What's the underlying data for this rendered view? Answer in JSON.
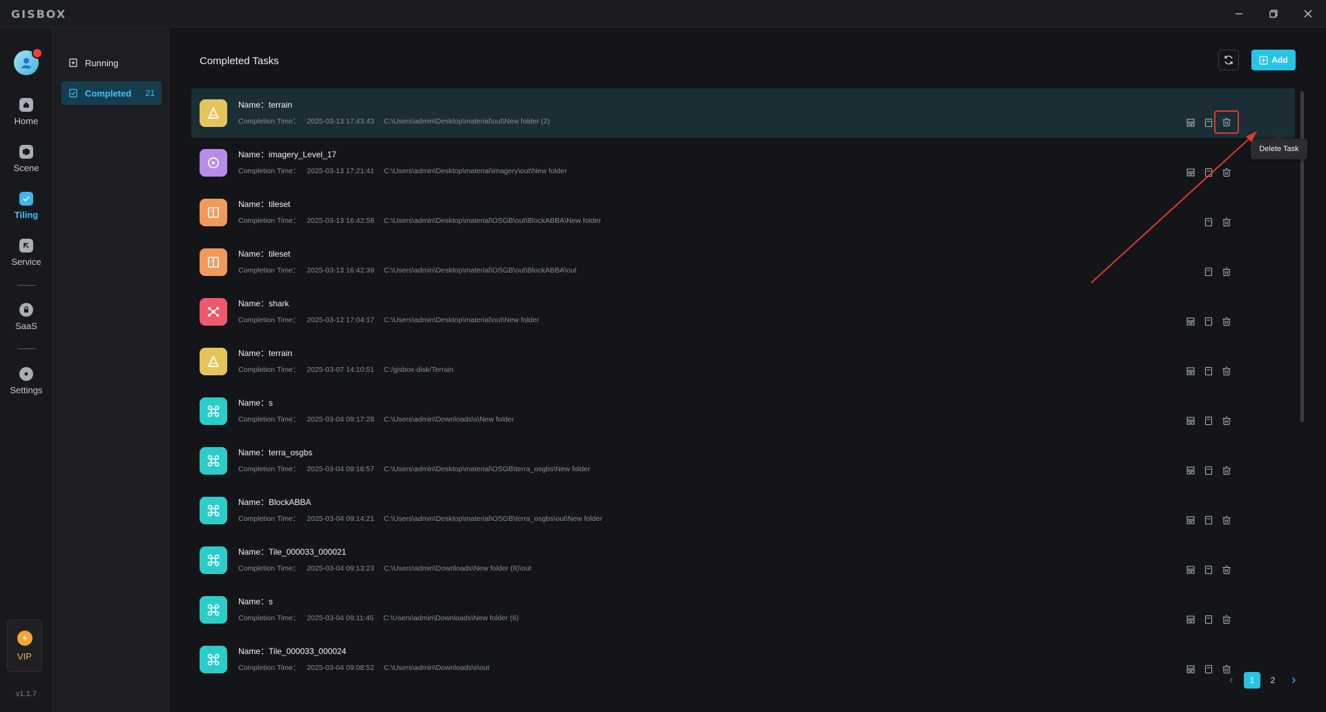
{
  "app": {
    "logo": "GISBOX",
    "version": "v1.1.7"
  },
  "nav": {
    "items": [
      {
        "label": "Home",
        "icon": "home-icon"
      },
      {
        "label": "Scene",
        "icon": "cube-icon"
      },
      {
        "label": "Tiling",
        "icon": "tiling-icon",
        "active": true
      },
      {
        "label": "Service",
        "icon": "service-icon"
      },
      {
        "label": "SaaS",
        "icon": "lock-icon"
      },
      {
        "label": "Settings",
        "icon": "gear-icon"
      }
    ],
    "vip_label": "VIP"
  },
  "sub": {
    "running_label": "Running",
    "completed_label": "Completed",
    "completed_count": "21"
  },
  "main": {
    "title": "Completed Tasks",
    "add_label": "Add",
    "tooltip": "Delete Task",
    "name_prefix": "Name：",
    "time_prefix": "Completion Time：",
    "accent": "#28c4e8",
    "tasks": [
      {
        "name": "terrain",
        "time": "2025-03-13 17:43:43",
        "path": "C:\\Users\\admin\\Desktop\\material\\out\\New folder (2)",
        "type": "terrain",
        "actions": 3
      },
      {
        "name": "imagery_Level_17",
        "time": "2025-03-13 17:21:41",
        "path": "C:\\Users\\admin\\Desktop\\material\\imagery\\out\\New folder",
        "type": "imagery",
        "actions": 3
      },
      {
        "name": "tileset",
        "time": "2025-03-13 16:42:58",
        "path": "C:\\Users\\admin\\Desktop\\material\\OSGB\\out\\BlockABBA\\New folder",
        "type": "tileset",
        "actions": 2
      },
      {
        "name": "tileset",
        "time": "2025-03-13 16:42:39",
        "path": "C:\\Users\\admin\\Desktop\\material\\OSGB\\out\\BlockABBA\\out",
        "type": "tileset",
        "actions": 2
      },
      {
        "name": "shark",
        "time": "2025-03-12 17:04:17",
        "path": "C:\\Users\\admin\\Desktop\\material\\out\\New folder",
        "type": "model",
        "actions": 3
      },
      {
        "name": "terrain",
        "time": "2025-03-07 14:10:51",
        "path": "C:/gisbox-disk/Terrain",
        "type": "terrain",
        "actions": 3
      },
      {
        "name": "s",
        "time": "2025-03-04 09:17:28",
        "path": "C:\\Users\\admin\\Downloads\\s\\New folder",
        "type": "osgb",
        "actions": 3
      },
      {
        "name": "terra_osgbs",
        "time": "2025-03-04 09:18:57",
        "path": "C:\\Users\\admin\\Desktop\\material\\OSGB\\terra_osgbs\\New folder",
        "type": "osgb",
        "actions": 3
      },
      {
        "name": "BlockABBA",
        "time": "2025-03-04 09:14:21",
        "path": "C:\\Users\\admin\\Desktop\\material\\OSGB\\terra_osgbs\\out\\New folder",
        "type": "osgb",
        "actions": 3
      },
      {
        "name": "Tile_000033_000021",
        "time": "2025-03-04 09:13:23",
        "path": "C:\\Users\\admin\\Downloads\\New folder (8)\\out",
        "type": "osgb",
        "actions": 3
      },
      {
        "name": "s",
        "time": "2025-03-04 09:11:45",
        "path": "C:\\Users\\admin\\Downloads\\New folder (8)",
        "type": "osgb",
        "actions": 3
      },
      {
        "name": "Tile_000033_000024",
        "time": "2025-03-04 09:08:52",
        "path": "C:\\Users\\admin\\Downloads\\s\\out",
        "type": "osgb",
        "actions": 3
      }
    ],
    "type_colors": {
      "terrain": "#e3c55a",
      "imagery": "#b68ee8",
      "tileset": "#f19a5b",
      "model": "#f0586e",
      "osgb": "#2ccdc9"
    }
  },
  "pagination": {
    "pages": [
      "1",
      "2"
    ],
    "current": "1"
  }
}
